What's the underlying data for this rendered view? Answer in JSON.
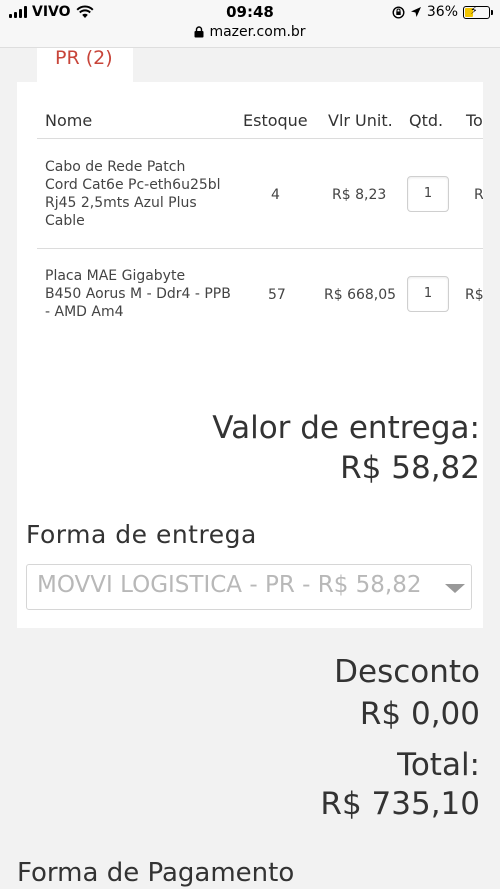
{
  "status_bar": {
    "carrier": "VIVO",
    "time": "09:48",
    "url": "mazer.com.br",
    "battery": "36%",
    "battery_level": 0.36
  },
  "tab": {
    "label": "PR (2)"
  },
  "table": {
    "headers": [
      "Nome",
      "Estoque",
      "Vlr Unit.",
      "Qtd.",
      "To"
    ],
    "rows": [
      {
        "name_lines": [
          "Cabo de Rede Patch",
          "Cord Cat6e Pc-eth6u25bl",
          "Rj45 2,5mts Azul Plus",
          "Cable"
        ],
        "stock": "4",
        "unit_price": "R$ 8,23",
        "qty": "1",
        "total": "R"
      },
      {
        "name_lines": [
          "Placa MAE Gigabyte",
          "B450 Aorus M - Ddr4 - PPB",
          "- AMD Am4"
        ],
        "stock": "57",
        "unit_price": "R$ 668,05",
        "qty": "1",
        "total": "R$"
      }
    ]
  },
  "delivery": {
    "value_label": "Valor de entrega:",
    "value": "R$ 58,82",
    "method_label": "Forma de entrega",
    "method_selected": "MOVVI LOGISTICA - PR - R$ 58,82"
  },
  "summary": {
    "discount_label": "Desconto",
    "discount": "R$ 0,00",
    "total_label": "Total:",
    "total": "R$ 735,10"
  },
  "payment": {
    "label": "Forma de Pagamento"
  },
  "colors": {
    "accent": "#c8453a",
    "background": "#f2f2f2",
    "card": "#ffffff"
  }
}
